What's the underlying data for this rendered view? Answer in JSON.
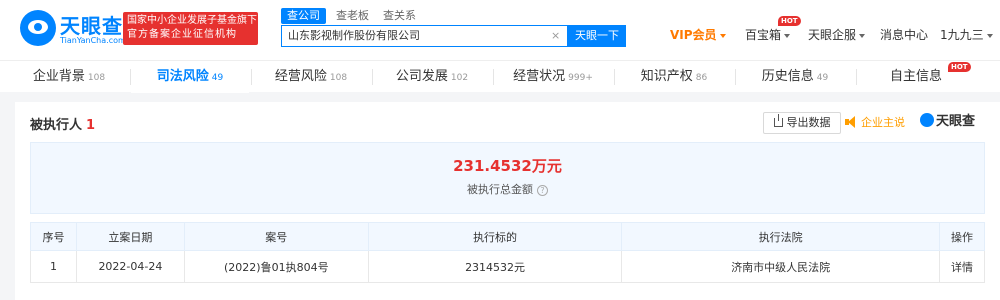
{
  "header": {
    "logo_name": "天眼查",
    "logo_domain": "TianYanCha.com",
    "gov_badge_line1": "国家中小企业发展子基金旗下",
    "gov_badge_line2": "官方备案企业征信机构",
    "search_tabs": [
      "查公司",
      "查老板",
      "查关系"
    ],
    "search_value": "山东影视制作股份有限公司",
    "search_clear": "×",
    "search_button": "天眼一下",
    "nav": {
      "vip": "VIP会员",
      "baibaoxiang": "百宝箱",
      "hot": "HOT",
      "enterprise": "天眼企服",
      "messages": "消息中心",
      "user": "1九九三"
    }
  },
  "tabs": [
    {
      "label": "企业背景",
      "count": "108"
    },
    {
      "label": "司法风险",
      "count": "49"
    },
    {
      "label": "经营风险",
      "count": "108"
    },
    {
      "label": "公司发展",
      "count": "102"
    },
    {
      "label": "经营状况",
      "count": "999+"
    },
    {
      "label": "知识产权",
      "count": "86"
    },
    {
      "label": "历史信息",
      "count": "49"
    },
    {
      "label": "自主信息",
      "count": ""
    }
  ],
  "tabs_hot": "HOT",
  "section": {
    "title": "被执行人",
    "count": "1",
    "export_label": "导出数据",
    "promo_label": "企业主说",
    "brand": "天眼查"
  },
  "summary": {
    "amount": "231.4532万元",
    "label": "被执行总金额",
    "help_icon": "?"
  },
  "table": {
    "headers": [
      "序号",
      "立案日期",
      "案号",
      "执行标的",
      "执行法院",
      "操作"
    ],
    "rows": [
      {
        "index": "1",
        "date": "2022-04-24",
        "case_no": "(2022)鲁01执804号",
        "amount": "2314532元",
        "court": "济南市中级人民法院",
        "action": "详情"
      }
    ]
  },
  "colors": {
    "brand_blue": "#0084ff",
    "alert_red": "#e6312f",
    "vip_orange": "#ff7a00"
  }
}
